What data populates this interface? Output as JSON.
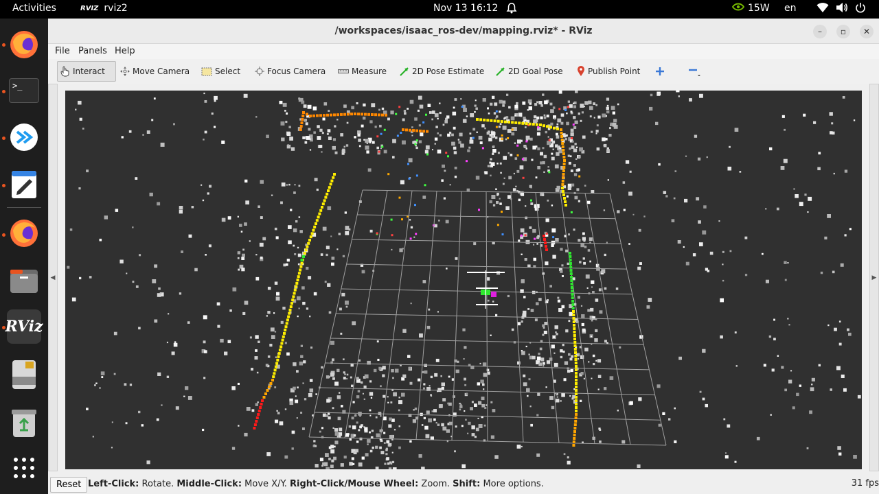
{
  "topbar": {
    "activities": "Activities",
    "app_name": "rviz2",
    "app_logo": "RVIZ",
    "clock": "Nov 13  16:12",
    "power_draw": "15W",
    "language": "en",
    "icons": [
      "bell-icon",
      "nvidia-icon",
      "wifi-icon",
      "volume-icon",
      "power-icon"
    ]
  },
  "dock": {
    "items": [
      {
        "name": "firefox",
        "running": true
      },
      {
        "name": "terminal",
        "glyph": ">_",
        "running": true
      },
      {
        "name": "vscode",
        "running": true
      },
      {
        "name": "text-editor",
        "running": true
      },
      {
        "name": "firefox-2",
        "running": true
      },
      {
        "name": "files",
        "running": false
      },
      {
        "name": "rviz",
        "logo": "RViz",
        "running": true,
        "active": true
      },
      {
        "name": "drive",
        "running": false
      },
      {
        "name": "trash",
        "running": false
      },
      {
        "name": "show-apps",
        "running": false
      }
    ]
  },
  "window": {
    "title": "/workspaces/isaac_ros-dev/mapping.rviz* - RViz",
    "controls": {
      "minimize": "–",
      "maximize": "▫",
      "close": "✕"
    }
  },
  "menubar": {
    "file": "File",
    "panels": "Panels",
    "help": "Help"
  },
  "toolbar": {
    "interact": "Interact",
    "move_camera": "Move Camera",
    "select": "Select",
    "focus_camera": "Focus Camera",
    "measure": "Measure",
    "pose_estimate": "2D Pose Estimate",
    "goal_pose": "2D Goal Pose",
    "publish_point": "Publish Point"
  },
  "viewport": {
    "background": "#303030",
    "grid_color": "#a0a0a0",
    "path_colors": [
      "#ff8800",
      "#ffee00",
      "#2ee82e",
      "#ff1a1a",
      "#ffa500"
    ]
  },
  "statusbar": {
    "reset": "Reset",
    "left_click_key": "Left-Click:",
    "left_click_val": " Rotate. ",
    "middle_click_key": "Middle-Click:",
    "middle_click_val": " Move X/Y. ",
    "right_click_key": "Right-Click/Mouse Wheel:",
    "right_click_val": " Zoom. ",
    "shift_key": "Shift:",
    "shift_val": " More options.",
    "fps": "31 fps"
  }
}
